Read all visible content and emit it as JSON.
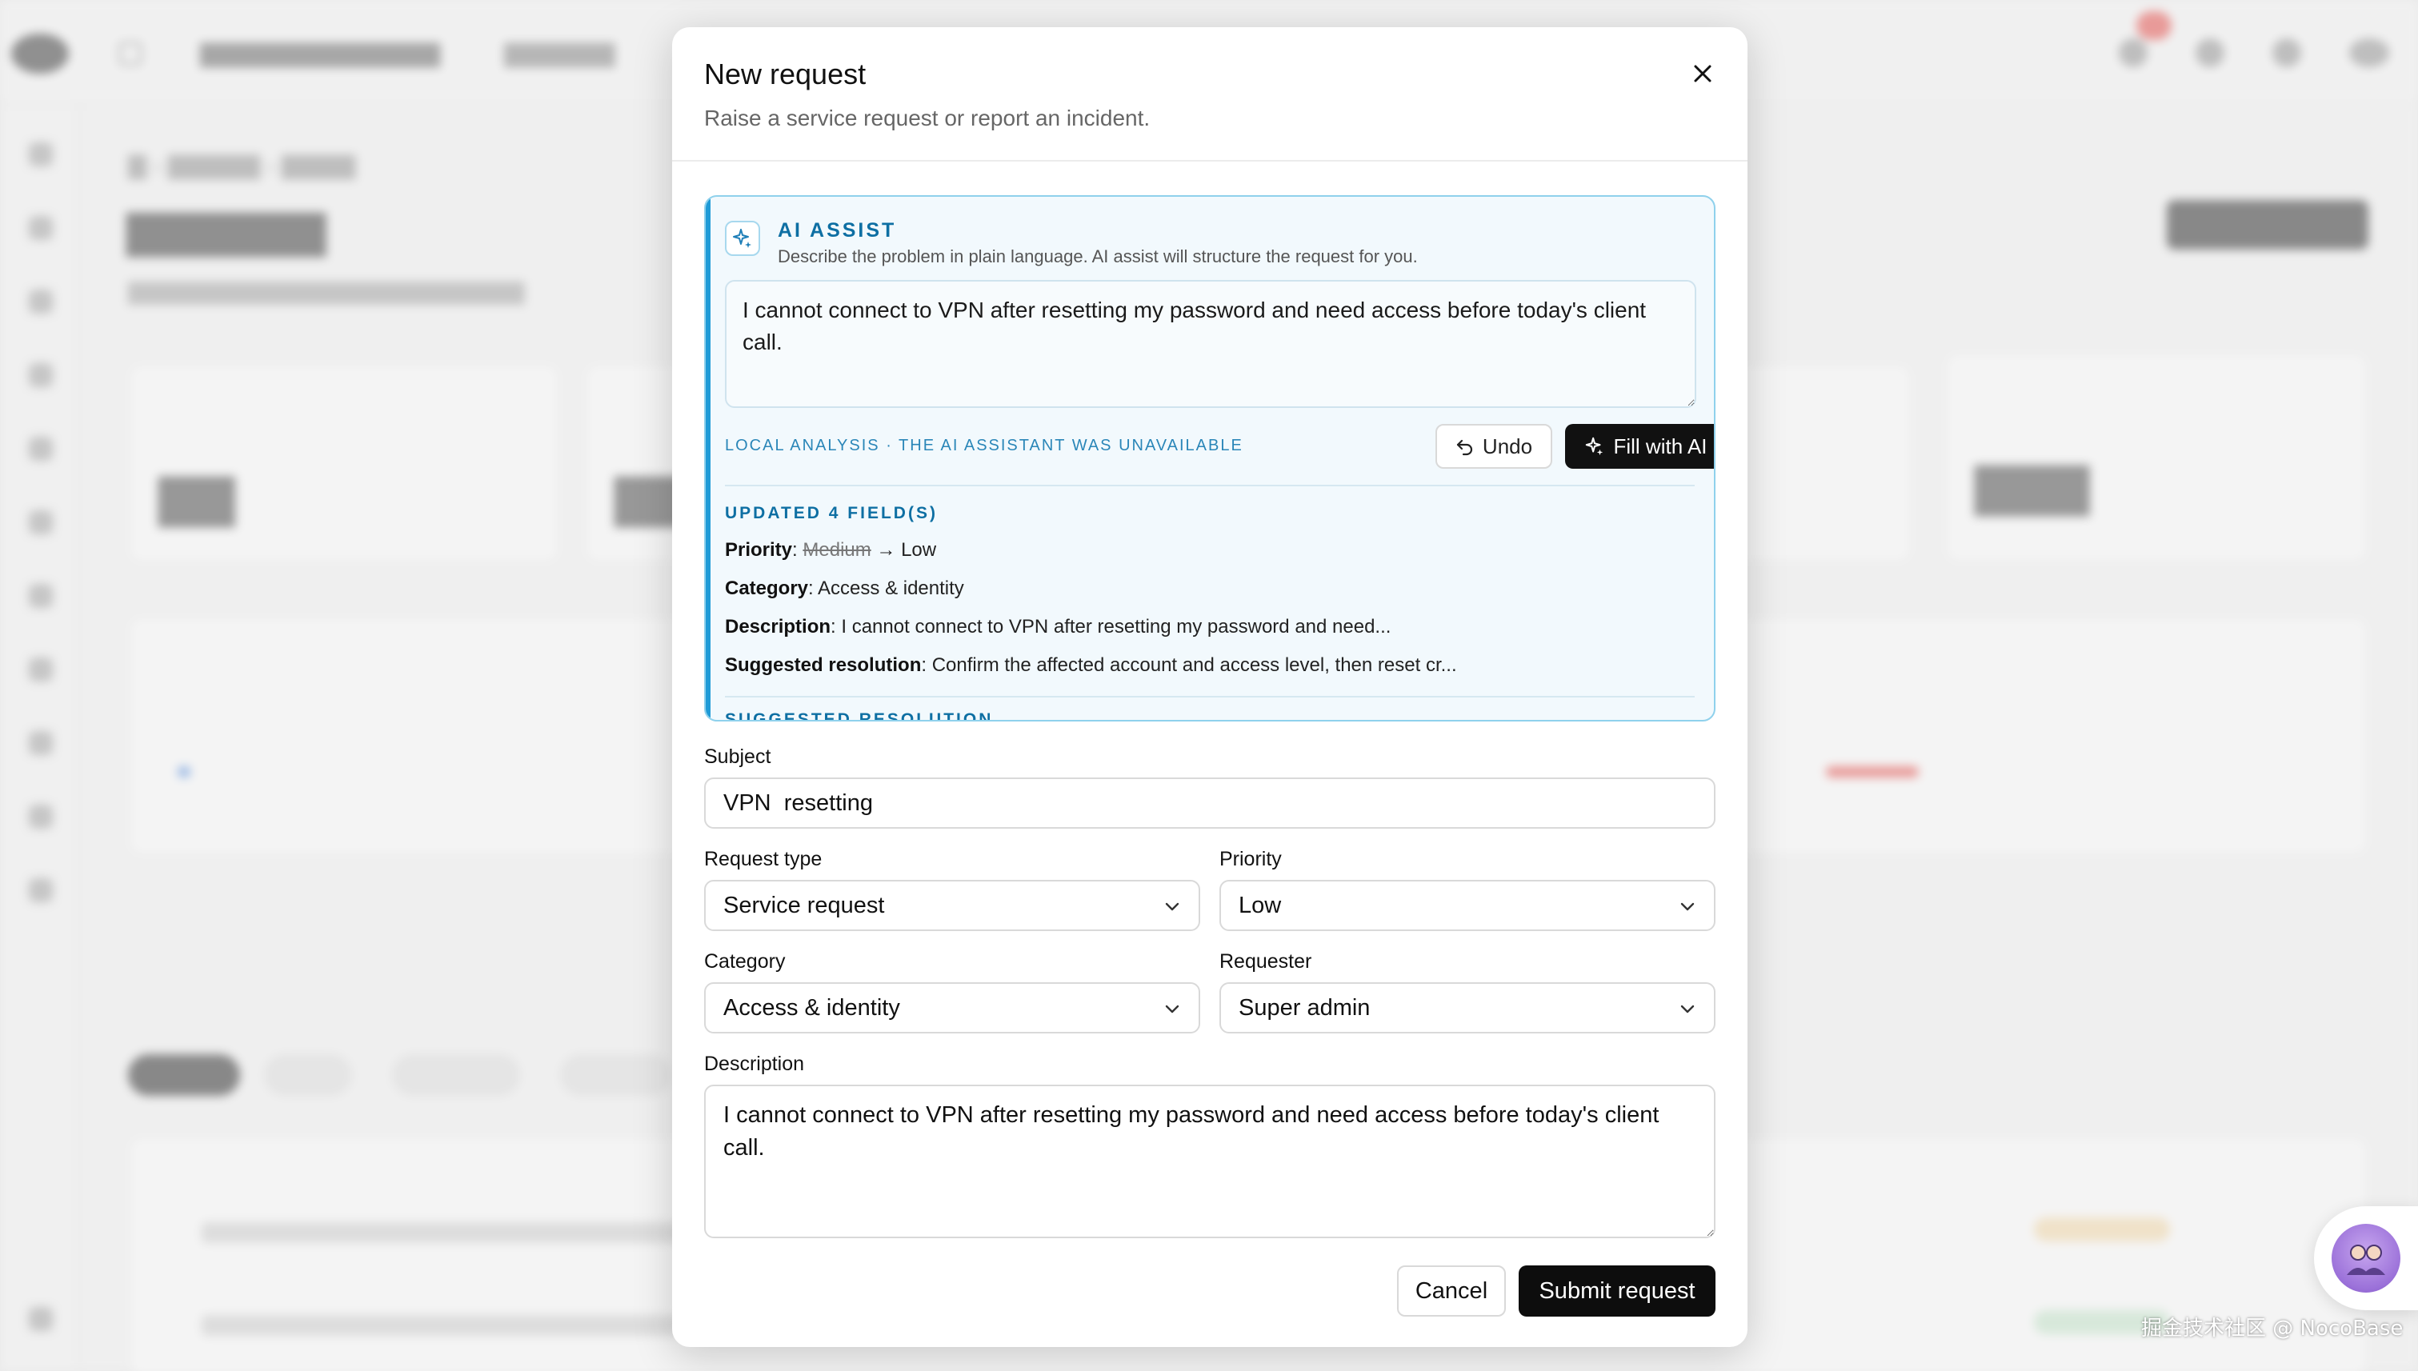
{
  "modal": {
    "title": "New request",
    "description": "Raise a service request or report an incident.",
    "close_icon": "close-icon"
  },
  "ai_assist": {
    "title": "AI ASSIST",
    "subtitle": "Describe the problem in plain language. AI assist will structure the request for you.",
    "input_value": "I cannot connect to VPN after resetting my password and need access before today's client call.",
    "status": "LOCAL ANALYSIS · THE AI ASSISTANT WAS UNAVAILABLE",
    "undo_label": "Undo",
    "fill_label": "Fill with AI",
    "updated_heading": "UPDATED 4 FIELD(S)",
    "changes": {
      "priority": {
        "label": "Priority",
        "old": "Medium",
        "arrow": "→",
        "new": "Low"
      },
      "category": {
        "label": "Category",
        "value": "Access & identity"
      },
      "description": {
        "label": "Description",
        "value": "I cannot connect to VPN after resetting my password and need..."
      },
      "resolution": {
        "label": "Suggested resolution",
        "value": "Confirm the affected account and access level, then reset cr..."
      }
    },
    "next_section": "SUGGESTED RESOLUTION",
    "accent_color": "#1f9bd7",
    "icons": [
      "sparkle-icon",
      "undo-icon"
    ]
  },
  "form": {
    "subject_label": "Subject",
    "subject_value": "VPN  resetting",
    "request_type_label": "Request type",
    "request_type_value": "Service request",
    "priority_label": "Priority",
    "priority_value": "Low",
    "category_label": "Category",
    "category_value": "Access & identity",
    "requester_label": "Requester",
    "requester_value": "Super admin",
    "description_label": "Description",
    "description_value": "I cannot connect to VPN after resetting my password and need access before today's client call.",
    "cancel_label": "Cancel",
    "submit_label": "Submit request"
  },
  "watermark": "掘金技术社区 @ NocoBase"
}
